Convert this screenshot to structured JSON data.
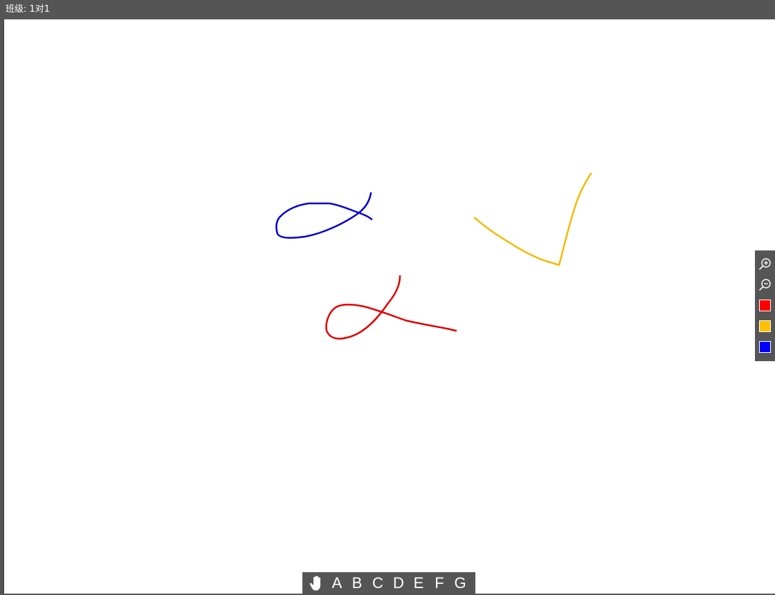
{
  "window": {
    "title": "班级: 1对1"
  },
  "strokes": [
    {
      "color": "#0000cc",
      "name": "blue-alpha-stroke"
    },
    {
      "color": "#f5b800",
      "name": "yellow-check-stroke"
    },
    {
      "color": "#e00000",
      "name": "red-alpha-stroke"
    }
  ],
  "side_toolbar": {
    "tools": [
      {
        "name": "zoom-in-icon"
      },
      {
        "name": "zoom-out-icon"
      }
    ],
    "colors": [
      "#ff0000",
      "#ffc000",
      "#0000ff"
    ]
  },
  "bottom_toolbar": {
    "hand_icon": "hand-icon",
    "letters": [
      "A",
      "B",
      "C",
      "D",
      "E",
      "F",
      "G"
    ]
  }
}
